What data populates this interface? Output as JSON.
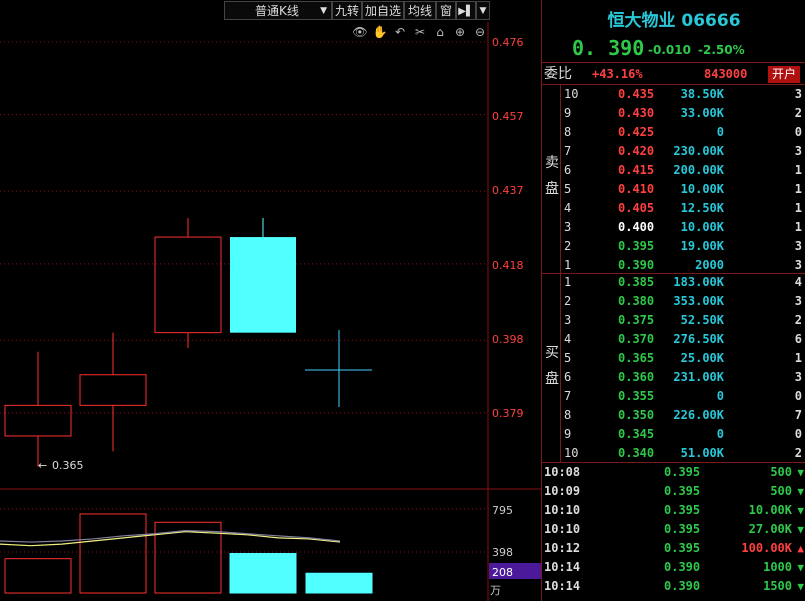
{
  "toolbar": {
    "chart_type_label": "普通K线",
    "buttons": [
      "九转",
      "加自选",
      "均线",
      "窗"
    ]
  },
  "axis_labels": {
    "price_ticks": [
      "0.476",
      "0.457",
      "0.437",
      "0.418",
      "0.398",
      "0.379"
    ],
    "volume_ticks": [
      "795",
      "398",
      "208"
    ],
    "volume_unit": "万",
    "min_price_marker": "0.365"
  },
  "quote": {
    "name": "恒大物业 06666",
    "price": "0. 390",
    "change": "-0.010",
    "change_pct": "-2.50%",
    "ratio_label": "委比",
    "ratio_value": "+43.16%",
    "ratio_diff": "843000",
    "open_account_label": "开户",
    "sell_label": [
      "卖",
      "盘"
    ],
    "buy_label": [
      "买",
      "盘"
    ]
  },
  "asks": [
    {
      "level": "10",
      "price": "0.435",
      "volume": "38.50K",
      "count": "3",
      "color": "#ff4040"
    },
    {
      "level": "9",
      "price": "0.430",
      "volume": "33.00K",
      "count": "2",
      "color": "#ff4040"
    },
    {
      "level": "8",
      "price": "0.425",
      "volume": "0",
      "count": "0",
      "color": "#ff4040"
    },
    {
      "level": "7",
      "price": "0.420",
      "volume": "230.00K",
      "count": "3",
      "color": "#ff4040"
    },
    {
      "level": "6",
      "price": "0.415",
      "volume": "200.00K",
      "count": "1",
      "color": "#ff4040"
    },
    {
      "level": "5",
      "price": "0.410",
      "volume": "10.00K",
      "count": "1",
      "color": "#ff4040"
    },
    {
      "level": "4",
      "price": "0.405",
      "volume": "12.50K",
      "count": "1",
      "color": "#ff4040"
    },
    {
      "level": "3",
      "price": "0.400",
      "volume": "10.00K",
      "count": "1",
      "color": "#ffffff"
    },
    {
      "level": "2",
      "price": "0.395",
      "volume": "19.00K",
      "count": "3",
      "color": "#2ec84a"
    },
    {
      "level": "1",
      "price": "0.390",
      "volume": "2000",
      "count": "3",
      "color": "#2ec84a"
    }
  ],
  "bids": [
    {
      "level": "1",
      "price": "0.385",
      "volume": "183.00K",
      "count": "4"
    },
    {
      "level": "2",
      "price": "0.380",
      "volume": "353.00K",
      "count": "3"
    },
    {
      "level": "3",
      "price": "0.375",
      "volume": "52.50K",
      "count": "2"
    },
    {
      "level": "4",
      "price": "0.370",
      "volume": "276.50K",
      "count": "6"
    },
    {
      "level": "5",
      "price": "0.365",
      "volume": "25.00K",
      "count": "1"
    },
    {
      "level": "6",
      "price": "0.360",
      "volume": "231.00K",
      "count": "3"
    },
    {
      "level": "7",
      "price": "0.355",
      "volume": "0",
      "count": "0"
    },
    {
      "level": "8",
      "price": "0.350",
      "volume": "226.00K",
      "count": "7"
    },
    {
      "level": "9",
      "price": "0.345",
      "volume": "0",
      "count": "0"
    },
    {
      "level": "10",
      "price": "0.340",
      "volume": "51.00K",
      "count": "2"
    }
  ],
  "trades": [
    {
      "time": "10:08",
      "price": "0.395",
      "volume": "500",
      "dir": "down"
    },
    {
      "time": "10:09",
      "price": "0.395",
      "volume": "500",
      "dir": "down"
    },
    {
      "time": "10:10",
      "price": "0.395",
      "volume": "10.00K",
      "dir": "down"
    },
    {
      "time": "10:10",
      "price": "0.395",
      "volume": "27.00K",
      "dir": "down"
    },
    {
      "time": "10:12",
      "price": "0.395",
      "volume": "100.00K",
      "dir": "up"
    },
    {
      "time": "10:14",
      "price": "0.390",
      "volume": "1000",
      "dir": "down"
    },
    {
      "time": "10:14",
      "price": "0.390",
      "volume": "1500",
      "dir": "down"
    }
  ],
  "chart_data": {
    "type": "candlestick",
    "ylim": [
      0.36,
      0.48
    ],
    "candles": [
      {
        "open": 0.373,
        "close": 0.381,
        "high": 0.395,
        "low": 0.365,
        "color": "up"
      },
      {
        "open": 0.381,
        "close": 0.389,
        "high": 0.4,
        "low": 0.369,
        "color": "up"
      },
      {
        "open": 0.4,
        "close": 0.425,
        "high": 0.43,
        "low": 0.396,
        "color": "up"
      },
      {
        "open": 0.425,
        "close": 0.4,
        "high": 0.43,
        "low": 0.4,
        "color": "down"
      },
      {
        "open": 0.39,
        "close": 0.39,
        "high": 0.4,
        "low": 0.38,
        "color": "flat"
      }
    ],
    "volume": {
      "ylim": [
        0,
        1000
      ],
      "values": [
        330,
        760,
        680,
        380,
        190
      ],
      "ma_line": [
        470,
        455,
        470,
        500,
        530,
        560,
        590,
        575,
        560,
        530,
        520,
        490
      ],
      "ma_line2": [
        500,
        490,
        500,
        520,
        550,
        570,
        600,
        590,
        570,
        550,
        530,
        500
      ]
    }
  },
  "colors": {
    "up": "#ff3030",
    "down": "#50ffff",
    "grid": "#8a1010",
    "axis_text": "#ff4040",
    "bid": "#2ec84a"
  }
}
